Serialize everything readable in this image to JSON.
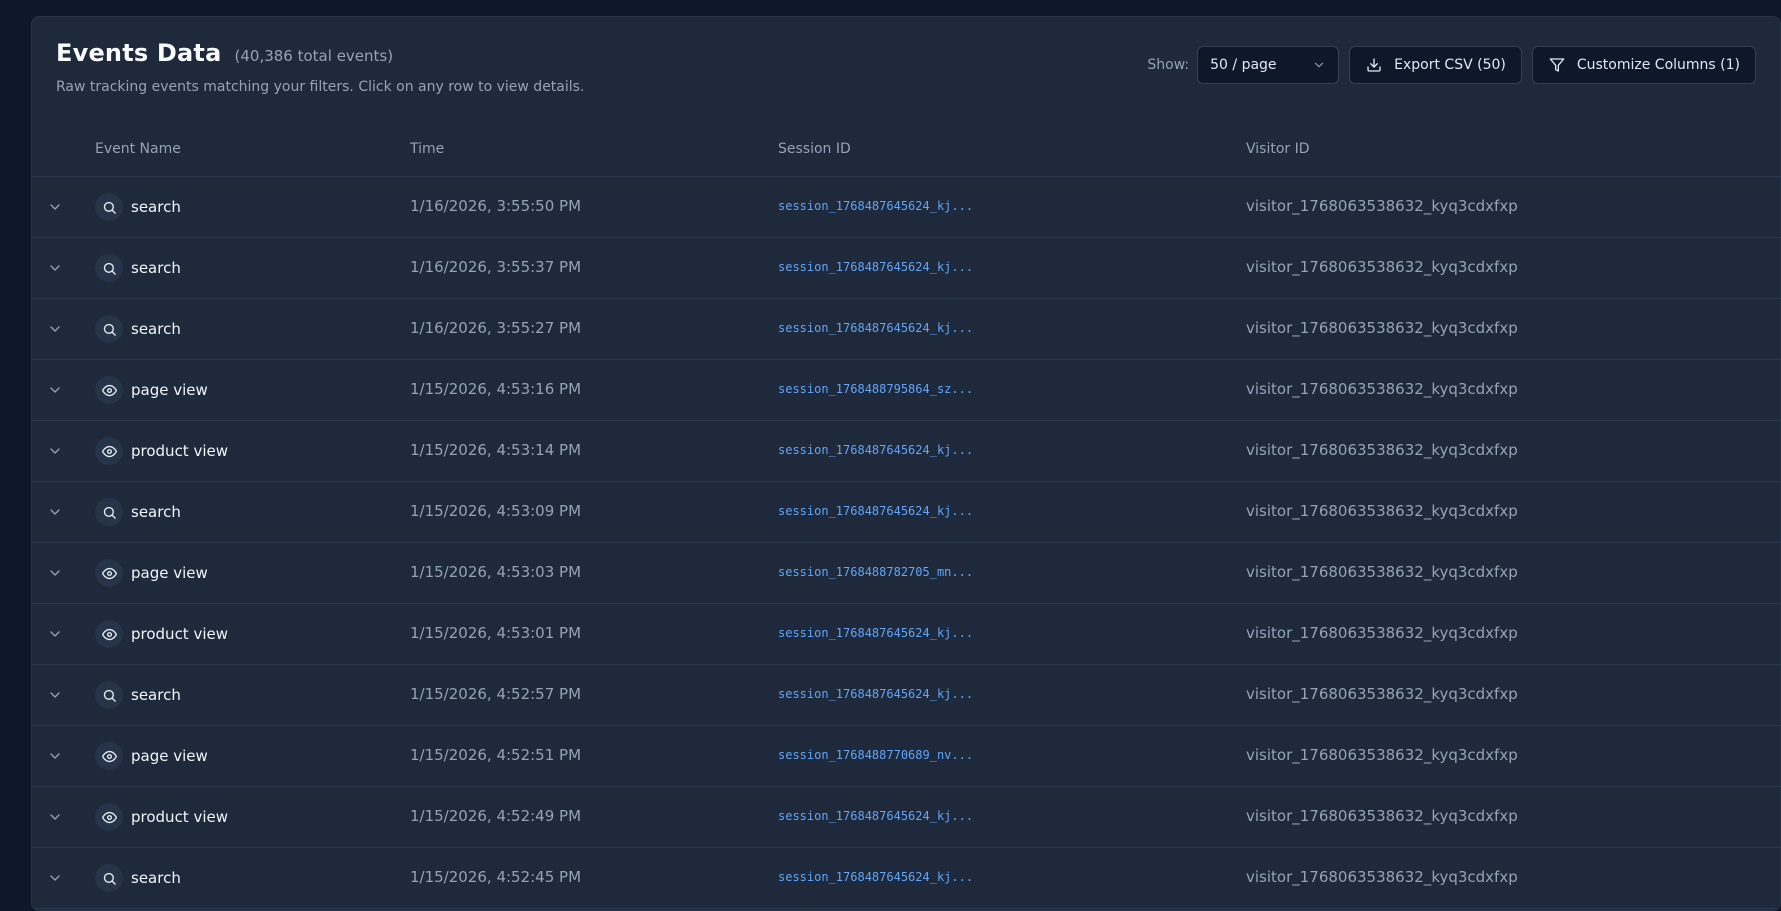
{
  "header": {
    "title": "Events Data",
    "total": "(40,386 total events)",
    "subtitle": "Raw tracking events matching your filters. Click on any row to view details."
  },
  "controls": {
    "show_label": "Show:",
    "page_size": "50 / page",
    "export_label": "Export CSV (50)",
    "customize_label": "Customize Columns (1)"
  },
  "columns": {
    "event_name": "Event Name",
    "time": "Time",
    "session_id": "Session ID",
    "visitor_id": "Visitor ID"
  },
  "rows": [
    {
      "event": "search",
      "icon": "search-icon",
      "time": "1/16/2026, 3:55:50 PM",
      "session": "session_1768487645624_kj...",
      "visitor": "visitor_1768063538632_kyq3cdxfxp"
    },
    {
      "event": "search",
      "icon": "search-icon",
      "time": "1/16/2026, 3:55:37 PM",
      "session": "session_1768487645624_kj...",
      "visitor": "visitor_1768063538632_kyq3cdxfxp"
    },
    {
      "event": "search",
      "icon": "search-icon",
      "time": "1/16/2026, 3:55:27 PM",
      "session": "session_1768487645624_kj...",
      "visitor": "visitor_1768063538632_kyq3cdxfxp"
    },
    {
      "event": "page view",
      "icon": "eye-icon",
      "time": "1/15/2026, 4:53:16 PM",
      "session": "session_1768488795864_sz...",
      "visitor": "visitor_1768063538632_kyq3cdxfxp"
    },
    {
      "event": "product view",
      "icon": "eye-icon",
      "time": "1/15/2026, 4:53:14 PM",
      "session": "session_1768487645624_kj...",
      "visitor": "visitor_1768063538632_kyq3cdxfxp"
    },
    {
      "event": "search",
      "icon": "search-icon",
      "time": "1/15/2026, 4:53:09 PM",
      "session": "session_1768487645624_kj...",
      "visitor": "visitor_1768063538632_kyq3cdxfxp"
    },
    {
      "event": "page view",
      "icon": "eye-icon",
      "time": "1/15/2026, 4:53:03 PM",
      "session": "session_1768488782705_mn...",
      "visitor": "visitor_1768063538632_kyq3cdxfxp"
    },
    {
      "event": "product view",
      "icon": "eye-icon",
      "time": "1/15/2026, 4:53:01 PM",
      "session": "session_1768487645624_kj...",
      "visitor": "visitor_1768063538632_kyq3cdxfxp"
    },
    {
      "event": "search",
      "icon": "search-icon",
      "time": "1/15/2026, 4:52:57 PM",
      "session": "session_1768487645624_kj...",
      "visitor": "visitor_1768063538632_kyq3cdxfxp"
    },
    {
      "event": "page view",
      "icon": "eye-icon",
      "time": "1/15/2026, 4:52:51 PM",
      "session": "session_1768488770689_nv...",
      "visitor": "visitor_1768063538632_kyq3cdxfxp"
    },
    {
      "event": "product view",
      "icon": "eye-icon",
      "time": "1/15/2026, 4:52:49 PM",
      "session": "session_1768487645624_kj...",
      "visitor": "visitor_1768063538632_kyq3cdxfxp"
    },
    {
      "event": "search",
      "icon": "search-icon",
      "time": "1/15/2026, 4:52:45 PM",
      "session": "session_1768487645624_kj...",
      "visitor": "visitor_1768063538632_kyq3cdxfxp"
    }
  ]
}
